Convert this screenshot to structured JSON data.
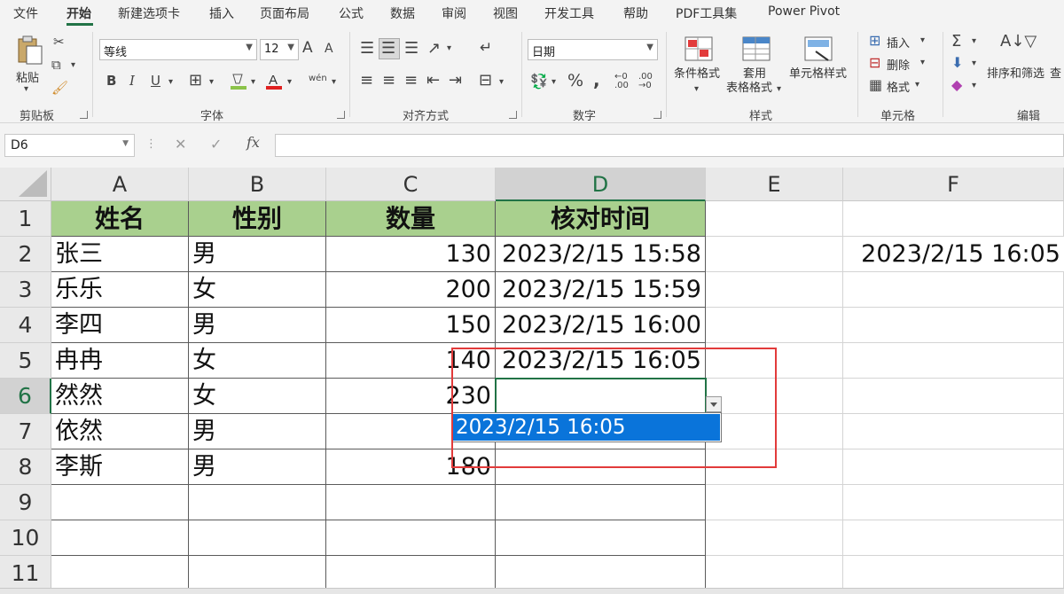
{
  "ribbon_tabs": [
    "文件",
    "开始",
    "新建选项卡",
    "插入",
    "页面布局",
    "公式",
    "数据",
    "审阅",
    "视图",
    "开发工具",
    "帮助",
    "PDF工具集",
    "Power Pivot"
  ],
  "active_tab": "开始",
  "clipboard": {
    "paste_label": "粘贴",
    "group_label": "剪贴板"
  },
  "font": {
    "name": "等线",
    "size": "12",
    "group_label": "字体",
    "grow": "A",
    "shrink": "A",
    "bold": "B",
    "italic": "I",
    "underline": "U",
    "wen": "wén",
    "accent_fill": "#8bc34a",
    "accent_font": "#e02020"
  },
  "alignment": {
    "group_label": "对齐方式"
  },
  "number": {
    "format": "日期",
    "group_label": "数字",
    "percent": "%",
    "comma": ",",
    "inc_dec": "←0\n.00",
    "dec_dec": ".00\n→0"
  },
  "styles": {
    "group_label": "样式",
    "cond_format": "条件格式",
    "table_format_1": "套用",
    "table_format_2": "表格格式",
    "cell_styles": "单元格样式"
  },
  "cells": {
    "group_label": "单元格",
    "insert": "插入",
    "delete": "删除",
    "format": "格式"
  },
  "editing": {
    "group_label": "编辑",
    "sort_filter": "排序和筛选",
    "find": "查"
  },
  "name_box": "D6",
  "columns": [
    "A",
    "B",
    "C",
    "D",
    "E",
    "F"
  ],
  "selected_column": "D",
  "rows": [
    "1",
    "2",
    "3",
    "4",
    "5",
    "6",
    "7",
    "8",
    "9",
    "10",
    "11"
  ],
  "selected_row": "6",
  "header_row": [
    "姓名",
    "性别",
    "数量",
    "核对时间"
  ],
  "data_rows": [
    {
      "name": "张三",
      "gender": "男",
      "qty": "130",
      "time": "2023/2/15 15:58"
    },
    {
      "name": "乐乐",
      "gender": "女",
      "qty": "200",
      "time": "2023/2/15 15:59"
    },
    {
      "name": "李四",
      "gender": "男",
      "qty": "150",
      "time": "2023/2/15 16:00"
    },
    {
      "name": "冉冉",
      "gender": "女",
      "qty": "140",
      "time": "2023/2/15 16:05"
    },
    {
      "name": "然然",
      "gender": "女",
      "qty": "230",
      "time": ""
    },
    {
      "name": "依然",
      "gender": "男",
      "qty": "",
      "time": ""
    },
    {
      "name": "李斯",
      "gender": "男",
      "qty": "180",
      "time": ""
    }
  ],
  "f2_value": "2023/2/15 16:05",
  "dropdown_option": "2023/2/15 16:05",
  "highlight_color": "#e23b3b",
  "header_fill": "#a9d08e"
}
